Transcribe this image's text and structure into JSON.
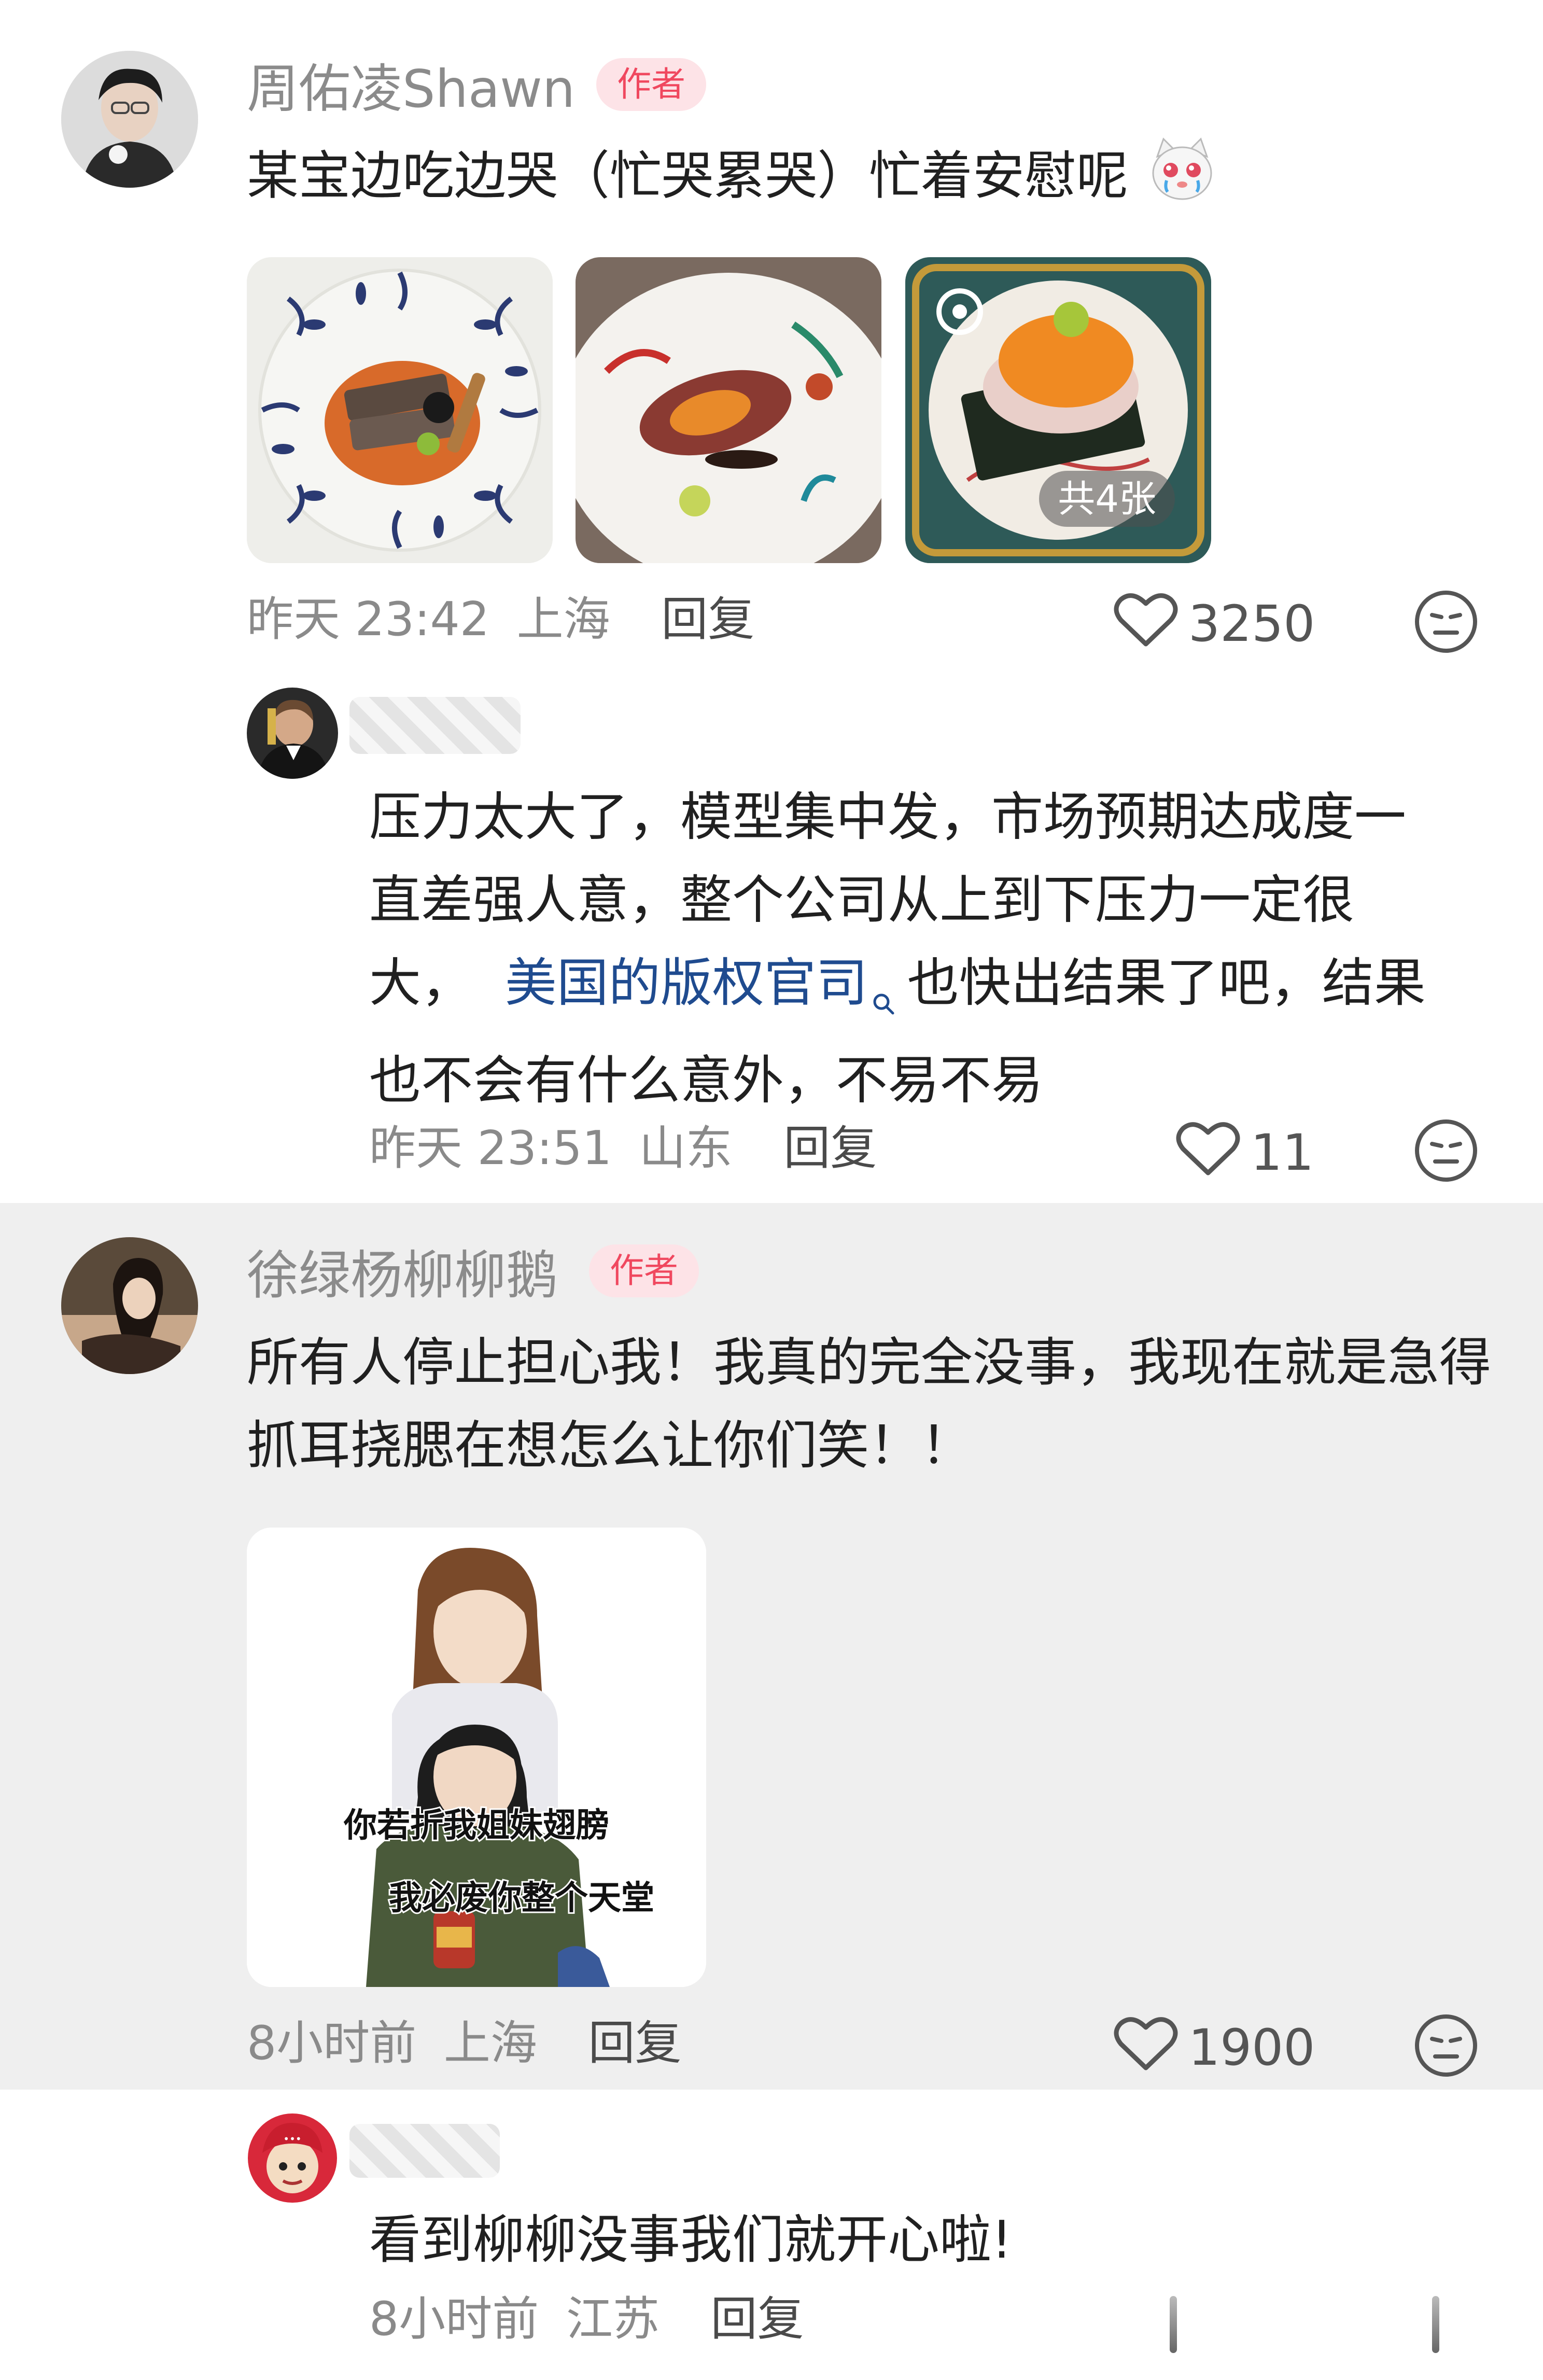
{
  "comments": [
    {
      "author": "周佑凌Shawn",
      "badge": "作者",
      "text": "某宝边吃边哭（忙哭累哭）忙着安慰呢",
      "image_count_label": "共4张",
      "time": "昨天 23:42",
      "location": "上海",
      "reply_label": "回复",
      "likes": "3250",
      "replies": [
        {
          "author": "",
          "text_before_link": "压力太大了，模型集中发，市场预期达成度一直差强人意，整个公司从上到下压力一定很大，",
          "link": "美国的版权官司",
          "text_after_link": "也快出结果了吧，结果也不会有什么意外，不易不易",
          "time": "昨天 23:51",
          "location": "山东",
          "reply_label": "回复",
          "likes": "11"
        }
      ]
    },
    {
      "author": "徐绿杨柳柳鹅",
      "badge": "作者",
      "text": "所有人停止担心我！我真的完全没事，我现在就是急得抓耳挠腮在想怎么让你们笑！！",
      "sticker_line1": "你若折我姐妹翅膀",
      "sticker_line2": "我必废你整个天堂",
      "time": "8小时前",
      "location": "上海",
      "reply_label": "回复",
      "likes": "1900",
      "replies": [
        {
          "author": "",
          "text": "看到柳柳没事我们就开心啦!",
          "time": "8小时前",
          "location": "江苏",
          "reply_label": "回复"
        }
      ]
    }
  ],
  "icons": {
    "like": "heart-outline-icon",
    "react": "neutral-face-icon",
    "search_hint": "search-icon"
  },
  "colors": {
    "badge_bg": "#fde3e7",
    "badge_fg": "#f0485f",
    "link": "#1f4b8f",
    "highlight_bg": "#efefef"
  }
}
